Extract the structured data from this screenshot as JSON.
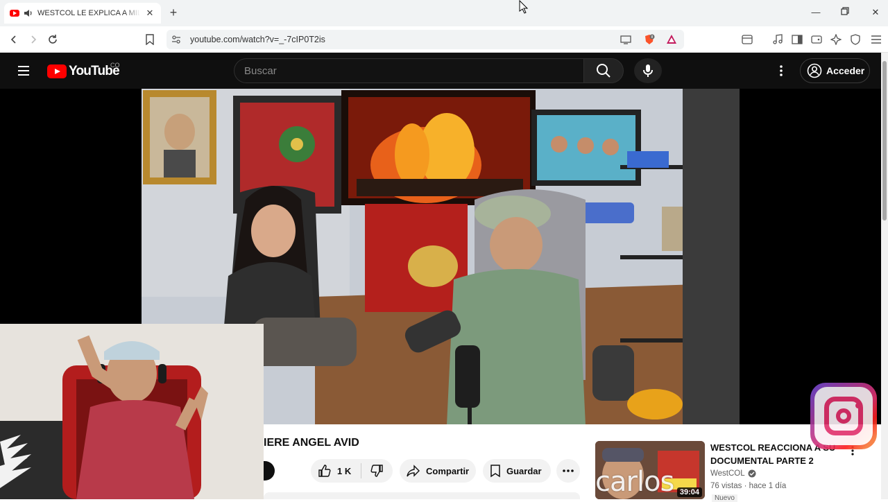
{
  "browser": {
    "tab_title": "WESTCOL LE EXPLICA A MILICA",
    "url": "youtube.com/watch?v=_-7cIP0T2is",
    "shield_count": "8"
  },
  "header": {
    "logo_text": "YouTube",
    "country_code": "CO",
    "search_placeholder": "Buscar",
    "signin_label": "Acceder"
  },
  "video": {
    "title_visible": "IERE ANGEL AVID",
    "likes": "1 K",
    "share_label": "Compartir",
    "save_label": "Guardar"
  },
  "recommendation": {
    "title": "WESTCOL REACCIONA A SU DOCUMENTAL PARTE 2",
    "channel": "WestCOL",
    "meta": "76 vistas · hace 1 día",
    "duration": "39:04",
    "badge": "Nuevo"
  },
  "overlay": {
    "watermark": "carlos"
  }
}
